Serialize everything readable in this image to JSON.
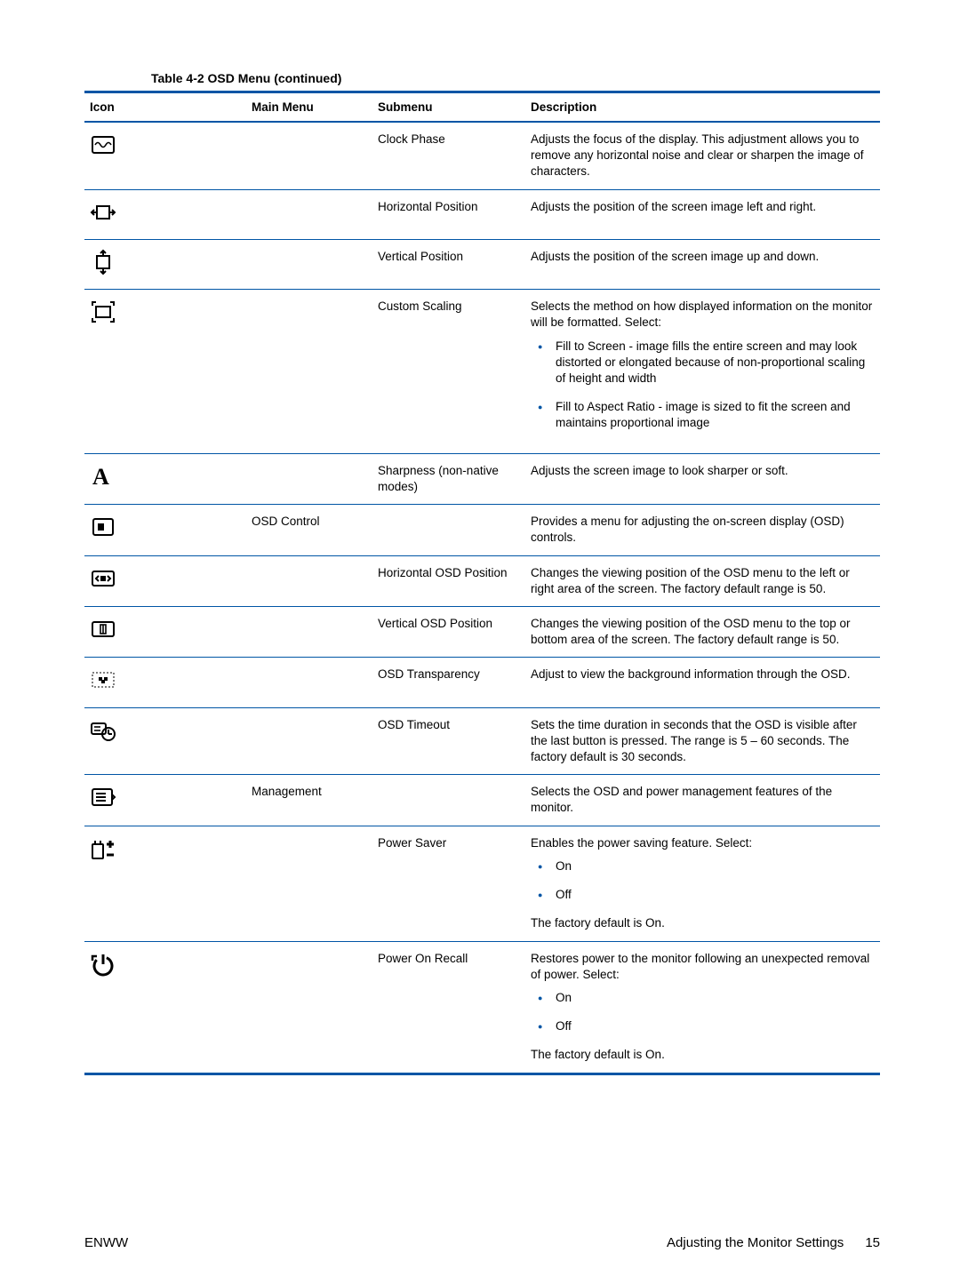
{
  "table_title": "Table 4-2  OSD Menu (continued)",
  "headers": {
    "icon": "Icon",
    "main": "Main Menu",
    "sub": "Submenu",
    "desc": "Description"
  },
  "rows": [
    {
      "icon": "clock-phase-icon",
      "main": "",
      "sub": "Clock Phase",
      "desc_plain": "Adjusts the focus of the display. This adjustment allows you to remove any horizontal noise and clear or sharpen the image of characters."
    },
    {
      "icon": "horizontal-position-icon",
      "main": "",
      "sub": "Horizontal Position",
      "desc_plain": "Adjusts the position of the screen image left and right."
    },
    {
      "icon": "vertical-position-icon",
      "main": "",
      "sub": "Vertical Position",
      "desc_plain": "Adjusts the position of the screen image up and down."
    },
    {
      "icon": "custom-scaling-icon",
      "main": "",
      "sub": "Custom Scaling",
      "desc_plain": "Selects the method on how displayed information on the monitor will be formatted. Select:",
      "bullets": [
        "Fill to Screen - image fills the entire screen and may look distorted or elongated because of non-proportional scaling of height and width",
        "Fill to Aspect Ratio - image is sized to fit the screen and maintains proportional image"
      ]
    },
    {
      "icon": "sharpness-icon",
      "main": "",
      "sub": "Sharpness (non-native modes)",
      "desc_plain": "Adjusts the screen image to look sharper or soft."
    },
    {
      "icon": "osd-control-icon",
      "main": "OSD Control",
      "sub": "",
      "desc_plain": "Provides a menu for adjusting the on-screen display (OSD) controls."
    },
    {
      "icon": "horizontal-osd-position-icon",
      "main": "",
      "sub": "Horizontal OSD Position",
      "desc_plain": "Changes the viewing position of the OSD menu to the left or right area of the screen. The factory default range is 50."
    },
    {
      "icon": "vertical-osd-position-icon",
      "main": "",
      "sub": "Vertical OSD Position",
      "desc_plain": "Changes the viewing position of the OSD menu to the top or bottom area of the screen. The factory default range is 50."
    },
    {
      "icon": "osd-transparency-icon",
      "main": "",
      "sub": "OSD Transparency",
      "desc_plain": "Adjust to view the background information through the OSD."
    },
    {
      "icon": "osd-timeout-icon",
      "main": "",
      "sub": "OSD Timeout",
      "desc_plain": "Sets the time duration in seconds that the OSD is visible after the last button is pressed. The range is 5 – 60 seconds. The factory default is 30 seconds."
    },
    {
      "icon": "management-icon",
      "main": "Management",
      "sub": "",
      "desc_plain": "Selects the OSD and power management features of the monitor."
    },
    {
      "icon": "power-saver-icon",
      "main": "",
      "sub": "Power Saver",
      "desc_plain": "Enables the power saving feature. Select:",
      "bullets": [
        "On",
        "Off"
      ],
      "default": "The factory default is On."
    },
    {
      "icon": "power-on-recall-icon",
      "main": "",
      "sub": "Power On Recall",
      "desc_plain": "Restores power to the monitor following an unexpected removal of power. Select:",
      "bullets": [
        "On",
        "Off"
      ],
      "default": "The factory default is On."
    }
  ],
  "footer": {
    "left": "ENWW",
    "right_text": "Adjusting the Monitor Settings",
    "page": "15"
  }
}
